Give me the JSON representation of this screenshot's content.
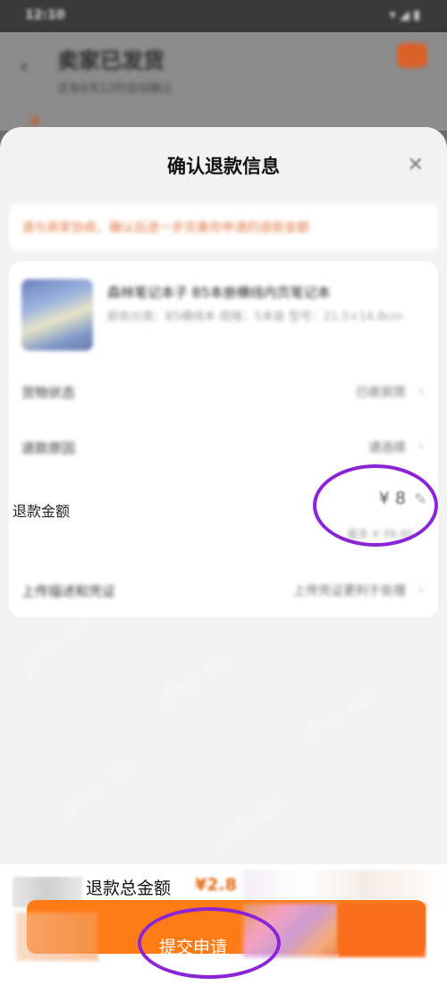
{
  "status_bar": {
    "time": "12:10",
    "icons": "▾ ◢ ▮"
  },
  "background_page": {
    "title": "卖家已发货",
    "subtitle": "还有6天12时自动确认",
    "back_icon": "chevron-left-icon",
    "chat_icon": "chat-bubble-icon"
  },
  "sheet": {
    "title": "确认退款信息",
    "close_icon": "close-icon",
    "notice": "请与商家协商，确认后进一步完善你申请的退款金额",
    "product": {
      "name": "森林笔记本子 B5本册横线内页笔记本",
      "spec": "颜色分类：B5横线本 规格：5本装 型号：21.5×14.8cm"
    },
    "rows": [
      {
        "label": "货物状态",
        "value": "已收到货"
      },
      {
        "label": "退款原因",
        "value": "请选择"
      }
    ],
    "refund": {
      "label": "退款金额",
      "amount": "¥ 8",
      "max_note": "最多 ¥ 39.40"
    },
    "upload": {
      "label": "上传描述和凭证",
      "value": "上传凭证更利于处理"
    }
  },
  "bottom_bar": {
    "total_label": "退款总金额",
    "total_amount": "¥2.8",
    "submit_label": "提交申请"
  },
  "watermark": "php.cn",
  "colors": {
    "accent": "#ff7b16",
    "annotation": "#8a24d6",
    "notice": "#e0763f"
  }
}
